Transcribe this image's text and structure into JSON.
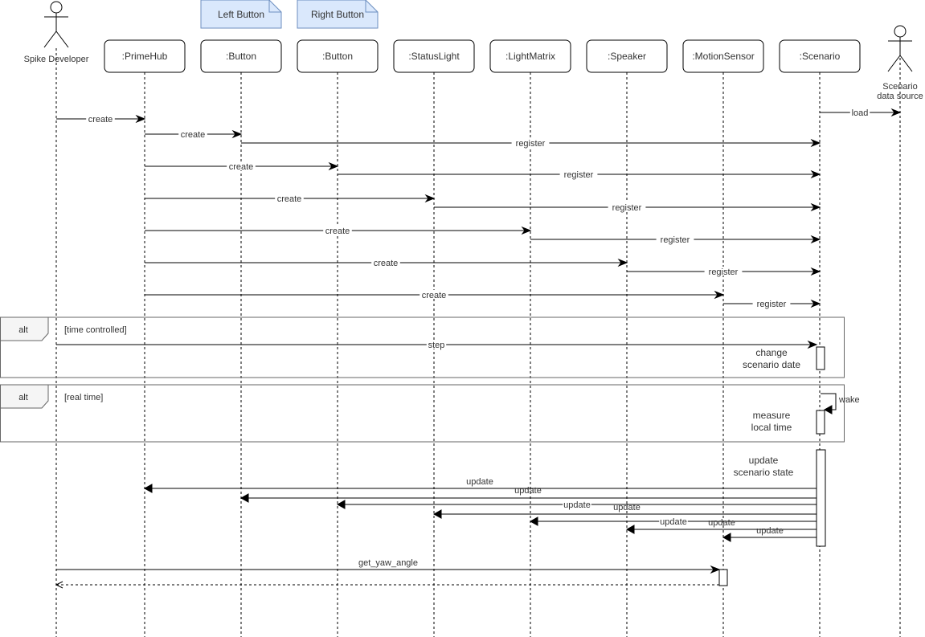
{
  "diagram": {
    "type": "UML sequence diagram",
    "actors": [
      {
        "id": "dev",
        "label": "Spike Developer"
      },
      {
        "id": "src",
        "label": "Scenario data source",
        "label_lines": [
          "Scenario",
          "data source"
        ]
      }
    ],
    "participants": [
      {
        "id": "hub",
        "label": ":PrimeHub"
      },
      {
        "id": "btnL",
        "label": ":Button",
        "note": "Left Button"
      },
      {
        "id": "btnR",
        "label": ":Button",
        "note": "Right Button"
      },
      {
        "id": "status",
        "label": ":StatusLight"
      },
      {
        "id": "matrix",
        "label": ":LightMatrix"
      },
      {
        "id": "speaker",
        "label": ":Speaker"
      },
      {
        "id": "motion",
        "label": ":MotionSensor"
      },
      {
        "id": "scenario",
        "label": ":Scenario"
      }
    ],
    "messages": [
      {
        "from": "scenario",
        "to": "src",
        "label": "load",
        "kind": "sync"
      },
      {
        "from": "dev",
        "to": "hub",
        "label": "create",
        "kind": "sync"
      },
      {
        "from": "hub",
        "to": "btnL",
        "label": "create",
        "kind": "sync"
      },
      {
        "from": "btnL",
        "to": "scenario",
        "label": "register",
        "kind": "sync"
      },
      {
        "from": "hub",
        "to": "btnR",
        "label": "create",
        "kind": "sync"
      },
      {
        "from": "btnR",
        "to": "scenario",
        "label": "register",
        "kind": "sync"
      },
      {
        "from": "hub",
        "to": "status",
        "label": "create",
        "kind": "sync"
      },
      {
        "from": "status",
        "to": "scenario",
        "label": "register",
        "kind": "sync"
      },
      {
        "from": "hub",
        "to": "matrix",
        "label": "create",
        "kind": "sync"
      },
      {
        "from": "matrix",
        "to": "scenario",
        "label": "register",
        "kind": "sync"
      },
      {
        "from": "hub",
        "to": "speaker",
        "label": "create",
        "kind": "sync"
      },
      {
        "from": "speaker",
        "to": "scenario",
        "label": "register",
        "kind": "sync"
      },
      {
        "from": "hub",
        "to": "motion",
        "label": "create",
        "kind": "sync"
      },
      {
        "from": "motion",
        "to": "scenario",
        "label": "register",
        "kind": "sync"
      },
      {
        "from": "dev",
        "to": "scenario",
        "label": "step",
        "kind": "sync"
      },
      {
        "from": "scenario",
        "to": "scenario",
        "label": "wake",
        "kind": "self"
      },
      {
        "from": "scenario",
        "to": "hub",
        "label": "update",
        "kind": "async"
      },
      {
        "from": "scenario",
        "to": "btnL",
        "label": "update",
        "kind": "async"
      },
      {
        "from": "scenario",
        "to": "btnR",
        "label": "update",
        "kind": "async"
      },
      {
        "from": "scenario",
        "to": "status",
        "label": "update",
        "kind": "async"
      },
      {
        "from": "scenario",
        "to": "matrix",
        "label": "update",
        "kind": "async"
      },
      {
        "from": "scenario",
        "to": "speaker",
        "label": "update",
        "kind": "async"
      },
      {
        "from": "scenario",
        "to": "motion",
        "label": "update",
        "kind": "async"
      },
      {
        "from": "dev",
        "to": "motion",
        "label": "get_yaw_angle",
        "kind": "sync"
      },
      {
        "from": "motion",
        "to": "dev",
        "label": "",
        "kind": "return"
      }
    ],
    "fragments": [
      {
        "operator": "alt",
        "guard": "[time controlled]",
        "note": "change scenario date",
        "note_lines": [
          "change",
          "scenario date"
        ]
      },
      {
        "operator": "alt",
        "guard": "[real time]",
        "note": "measure local time",
        "note_lines": [
          "measure",
          "local time"
        ]
      }
    ],
    "activation_notes": [
      {
        "label": "update scenario state",
        "lines": [
          "update",
          "scenario state"
        ]
      }
    ]
  }
}
